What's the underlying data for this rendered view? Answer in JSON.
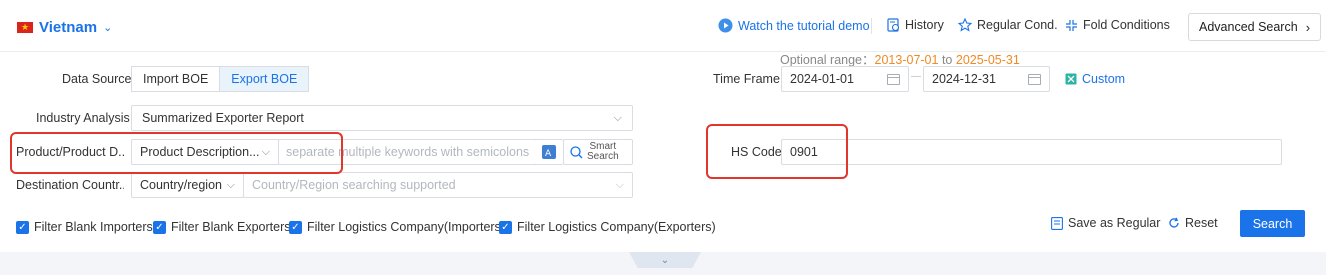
{
  "header": {
    "country": "Vietnam",
    "tutorial_label": "Watch the tutorial demo",
    "history_label": "History",
    "regular_cond_label": "Regular Cond.",
    "fold_label": "Fold Conditions",
    "advanced_label": "Advanced Search"
  },
  "range": {
    "prefix": "Optional range：",
    "start": "2013-07-01",
    "to": "to",
    "end": "2025-05-31"
  },
  "data_source": {
    "label": "Data Source",
    "options": [
      "Import BOE",
      "Export BOE"
    ],
    "selected": "Export BOE"
  },
  "time_frame": {
    "label": "Time Frame",
    "start": "2024-01-01",
    "end": "2024-12-31",
    "dash": "—",
    "custom_label": "Custom"
  },
  "industry": {
    "label": "Industry Analysis",
    "value": "Summarized Exporter Report"
  },
  "product": {
    "label": "Product/Product D...",
    "select_value": "Product Description...",
    "placeholder": "separate multiple keywords with semicolons",
    "smart_line1": "Smart",
    "smart_line2": "Search"
  },
  "hs_code": {
    "label": "HS Code",
    "value": "0901"
  },
  "destination": {
    "label": "Destination Countr...",
    "select_value": "Country/region",
    "placeholder": "Country/Region searching supported"
  },
  "filters": [
    {
      "label": "Filter Blank Importers",
      "checked": true
    },
    {
      "label": "Filter Blank Exporters",
      "checked": true
    },
    {
      "label": "Filter Logistics Company(Importers)",
      "checked": true
    },
    {
      "label": "Filter Logistics Company(Exporters)",
      "checked": true
    }
  ],
  "actions": {
    "save_regular": "Save as Regular",
    "reset": "Reset",
    "search": "Search"
  },
  "colors": {
    "accent": "#1a73e8",
    "highlight": "#e0362c",
    "range_date": "#f08a24"
  }
}
